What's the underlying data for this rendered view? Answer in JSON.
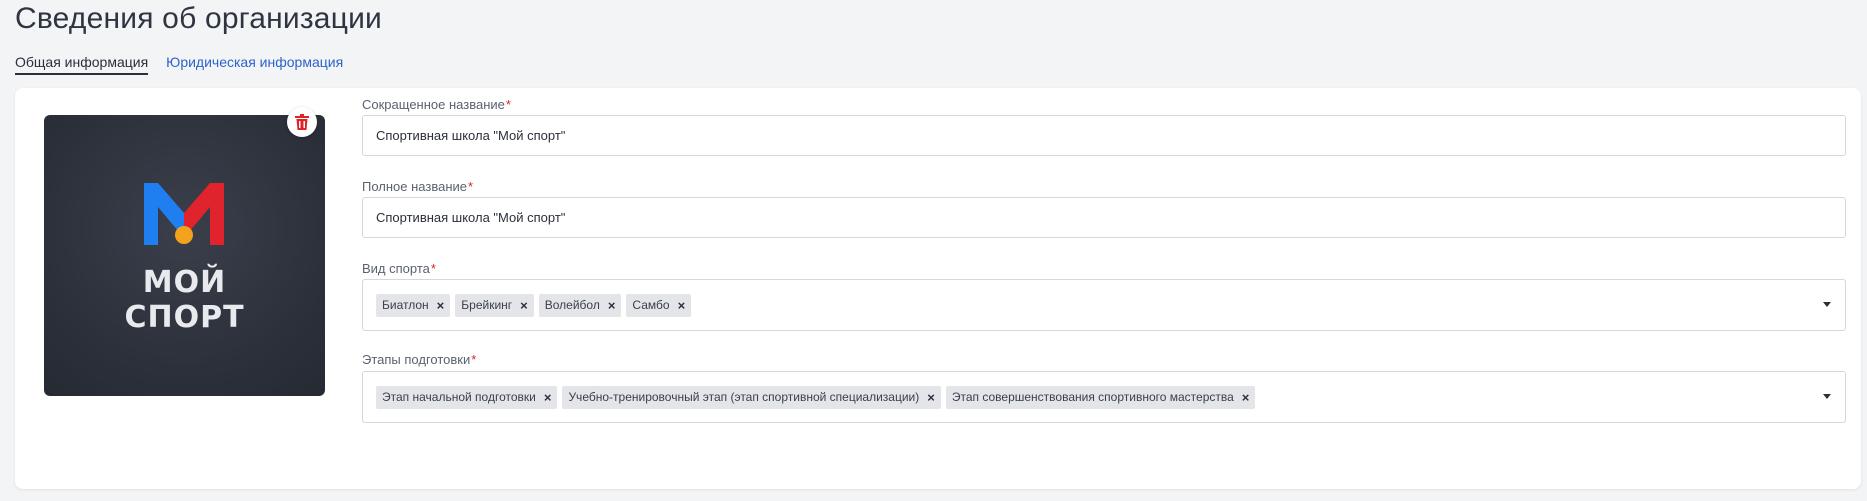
{
  "page": {
    "title": "Сведения об организации"
  },
  "tabs": [
    {
      "label": "Общая информация"
    },
    {
      "label": "Юридическая информация"
    }
  ],
  "logo": {
    "text_line1": "МОЙ",
    "text_line2": "СПОРТ",
    "colors": {
      "blue": "#1f7ff0",
      "red": "#e0232c",
      "dot": "#f2a31b",
      "background": "#2b2f39"
    },
    "delete_icon": "trash-icon"
  },
  "fields": {
    "short_name": {
      "label": "Сокращенное название",
      "required_mark": "*",
      "value": "Спортивная школа \"Мой спорт\""
    },
    "full_name": {
      "label": "Полное название",
      "required_mark": "*",
      "value": "Спортивная школа \"Мой спорт\""
    },
    "sport": {
      "label": "Вид спорта",
      "required_mark": "*",
      "chips": [
        {
          "label": "Биатлон"
        },
        {
          "label": "Брейкинг"
        },
        {
          "label": "Волейбол"
        },
        {
          "label": "Самбо"
        }
      ]
    },
    "stages": {
      "label": "Этапы подготовки",
      "required_mark": "*",
      "chips": [
        {
          "label": "Этап начальной подготовки"
        },
        {
          "label": "Учебно-тренировочный этап (этап спортивной специализации)"
        },
        {
          "label": "Этап совершенствования спортивного мастерства"
        }
      ]
    }
  },
  "chip_remove_glyph": "×",
  "colors": {
    "accent_link": "#2e63c9",
    "required": "#e02424",
    "delete": "#e02424"
  }
}
